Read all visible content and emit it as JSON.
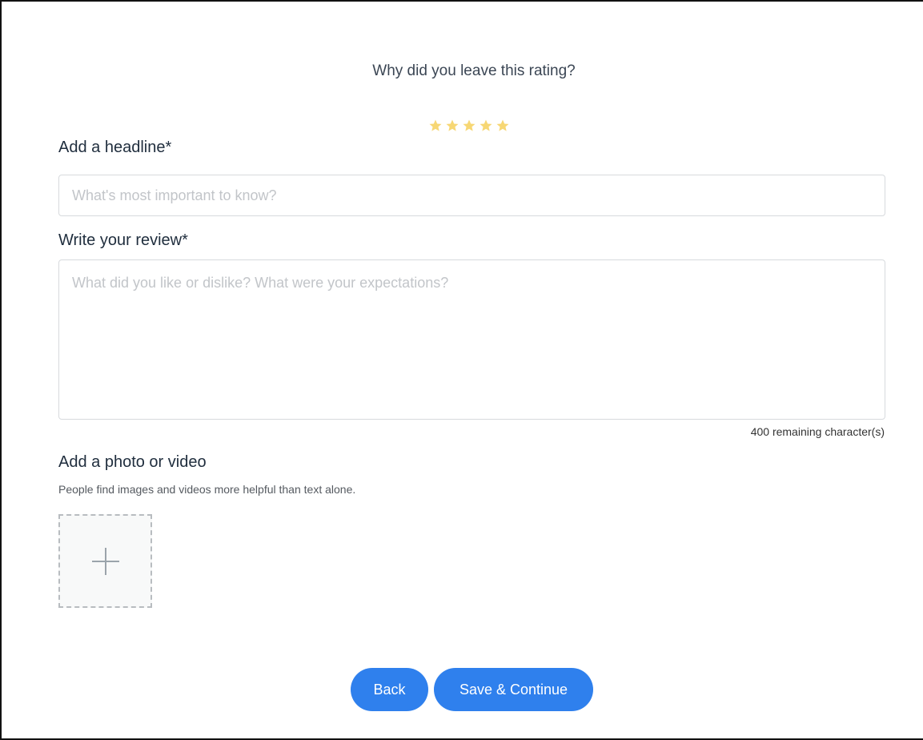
{
  "rating": {
    "question": "Why did you leave this rating?",
    "value": 5,
    "max": 5,
    "star_color": "#f7d774"
  },
  "headline": {
    "label": "Add a headline*",
    "placeholder": "What's most important to know?",
    "value": ""
  },
  "review": {
    "label": "Write your review*",
    "placeholder": "What did you like or dislike? What were your expectations?",
    "value": "",
    "remaining_text": "400 remaining character(s)"
  },
  "media": {
    "label": "Add a photo or video",
    "hint": "People find images and videos more helpful than text alone.",
    "add_icon": "plus-icon"
  },
  "actions": {
    "back_label": "Back",
    "save_label": "Save & Continue",
    "accent_color": "#2f80ed"
  }
}
